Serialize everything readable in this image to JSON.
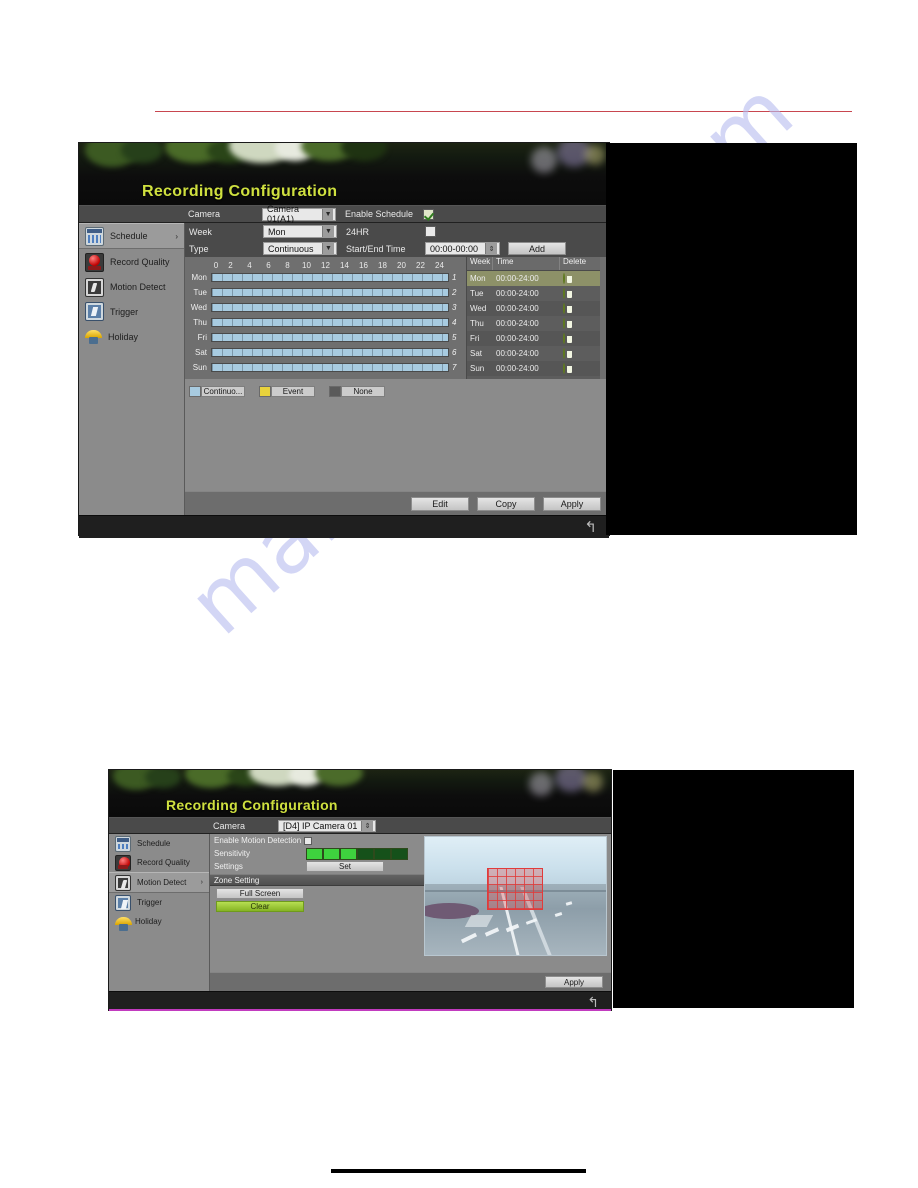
{
  "page": {
    "watermark_text": "manualshive.com",
    "rule_color": "#c8464f"
  },
  "panel_schedule": {
    "title": "Recording Configuration",
    "camera_label": "Camera",
    "camera_value": "Camera 01(A1)",
    "enable_schedule_label": "Enable Schedule",
    "enable_schedule_checked": "checked",
    "week_label": "Week",
    "week_value": "Mon",
    "hr24_label": "24HR",
    "hr24_checked": "unchecked",
    "type_label": "Type",
    "type_value": "Continuous",
    "start_end_label": "Start/End Time",
    "start_end_value": "00:00-00:00",
    "add_label": "Add",
    "sidebar": [
      {
        "label": "Schedule",
        "icon": "calendar-icon",
        "active": true
      },
      {
        "label": "Record Quality",
        "icon": "record-quality-icon",
        "active": false
      },
      {
        "label": "Motion Detect",
        "icon": "motion-detect-icon",
        "active": false
      },
      {
        "label": "Trigger",
        "icon": "trigger-icon",
        "active": false
      },
      {
        "label": "Holiday",
        "icon": "holiday-icon",
        "active": false
      }
    ],
    "hour_ticks": [
      "0",
      "2",
      "4",
      "6",
      "8",
      "10",
      "12",
      "14",
      "16",
      "18",
      "20",
      "22",
      "24"
    ],
    "grid_rows": [
      {
        "day": "Mon",
        "index": "1",
        "fill_percent": 100
      },
      {
        "day": "Tue",
        "index": "2",
        "fill_percent": 100
      },
      {
        "day": "Wed",
        "index": "3",
        "fill_percent": 100
      },
      {
        "day": "Thu",
        "index": "4",
        "fill_percent": 100
      },
      {
        "day": "Fri",
        "index": "5",
        "fill_percent": 100
      },
      {
        "day": "Sat",
        "index": "6",
        "fill_percent": 100
      },
      {
        "day": "Sun",
        "index": "7",
        "fill_percent": 100
      }
    ],
    "table_headers": [
      "Week",
      "Time",
      "Delete"
    ],
    "table_rows": [
      {
        "week": "Mon",
        "time": "00:00-24:00",
        "selected": true
      },
      {
        "week": "Tue",
        "time": "00:00-24:00",
        "selected": false
      },
      {
        "week": "Wed",
        "time": "00:00-24:00",
        "selected": false
      },
      {
        "week": "Thu",
        "time": "00:00-24:00",
        "selected": false
      },
      {
        "week": "Fri",
        "time": "00:00-24:00",
        "selected": false
      },
      {
        "week": "Sat",
        "time": "00:00-24:00",
        "selected": false
      },
      {
        "week": "Sun",
        "time": "00:00-24:00",
        "selected": false
      }
    ],
    "legend": [
      {
        "label": "Continuo...",
        "color": "#a8cbe0"
      },
      {
        "label": "Event",
        "color": "#e8d23c"
      },
      {
        "label": "None",
        "color": "#5a5a5a"
      }
    ],
    "buttons": {
      "edit": "Edit",
      "copy": "Copy",
      "apply": "Apply"
    },
    "back_icon": "back-arrow-icon"
  },
  "panel_motion": {
    "title": "Recording Configuration",
    "camera_label": "Camera",
    "camera_value": "[D4] IP Camera 01",
    "sidebar": [
      {
        "label": "Schedule",
        "icon": "calendar-icon",
        "active": false
      },
      {
        "label": "Record Quality",
        "icon": "record-quality-icon",
        "active": false
      },
      {
        "label": "Motion Detect",
        "icon": "motion-detect-icon",
        "active": true
      },
      {
        "label": "Trigger",
        "icon": "trigger-icon",
        "active": false
      },
      {
        "label": "Holiday",
        "icon": "holiday-icon",
        "active": false
      }
    ],
    "enable_motion_label": "Enable Motion Detection",
    "enable_motion_checked": "unchecked",
    "sensitivity_label": "Sensitivity",
    "sensitivity_level": 3,
    "sensitivity_total": 6,
    "settings_label": "Settings",
    "set_label": "Set",
    "zone_setting_label": "Zone Setting",
    "full_screen_label": "Full Screen",
    "clear_label": "Clear",
    "apply_label": "Apply",
    "back_icon": "back-arrow-icon"
  }
}
